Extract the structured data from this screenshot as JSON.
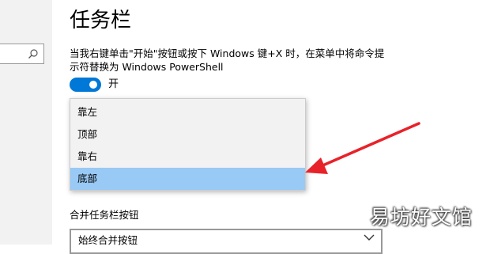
{
  "page": {
    "title": "任务栏"
  },
  "powershell_setting": {
    "description": "当我右键单击\"开始\"按钮或按下 Windows 键+X 时，在菜单中将命令提示符替换为 Windows PowerShell",
    "toggle_state_label": "开",
    "toggle_on": true
  },
  "taskbar_location_dropdown": {
    "options": [
      {
        "label": "靠左",
        "selected": false
      },
      {
        "label": "顶部",
        "selected": false
      },
      {
        "label": "靠右",
        "selected": false
      },
      {
        "label": "底部",
        "selected": true
      }
    ]
  },
  "combine_buttons": {
    "label": "合并任务栏按钮",
    "selected_value": "始终合并按钮"
  },
  "watermark": {
    "text": "易坊好文馆"
  },
  "colors": {
    "accent": "#0078d7",
    "selected_option": "#99c9f5",
    "annotation_arrow": "#e8222a"
  },
  "icons": {
    "search": "search-icon",
    "chevron": "chevron-down-icon"
  }
}
